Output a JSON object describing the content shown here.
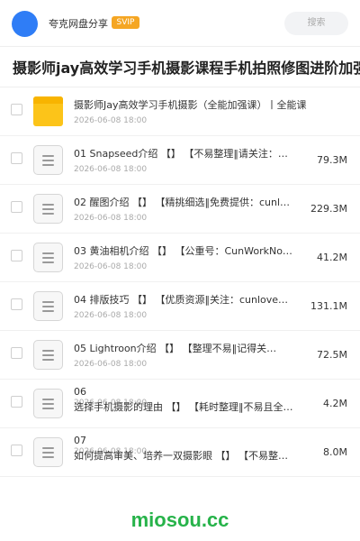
{
  "header": {
    "owner_name": "夸克网盘分享",
    "badge": "SVIP",
    "search_placeholder": "搜索"
  },
  "share_title": "摄影师jay高效学习手机摄影课程手机拍照修图进阶加强版教程",
  "files": [
    {
      "type": "folder",
      "name": "摄影师Jay高效学习手机摄影（全能加强课）丨全能课",
      "date": "2026-06-08 18:00",
      "size": ""
    },
    {
      "type": "file",
      "name": "01 Snapseed介绍 【】 【不易整理‖请关注：…",
      "date": "2026-06-08 18:00",
      "size": "79.3M"
    },
    {
      "type": "file",
      "name": "02 醒图介绍 【】 【精挑细选‖免费提供：cunlo…",
      "date": "2026-06-08 18:00",
      "size": "229.3M"
    },
    {
      "type": "file",
      "name": "03 黄油相机介绍 【】 【公重号：CunWorkNo…",
      "date": "2026-06-08 18:00",
      "size": "41.2M"
    },
    {
      "type": "file",
      "name": "04 排版技巧 【】 【优质资源‖关注：cunlove…",
      "date": "2026-06-08 18:00",
      "size": "131.1M"
    },
    {
      "type": "file",
      "name": "05 Lightroon介绍 【】 【整理不易‖记得关…",
      "date": "2026-06-08 18:00",
      "size": "72.5M"
    },
    {
      "type": "file",
      "name": "06",
      "name2": "选择手机摄影的理由 【】 【耗时整理‖不易且全免…",
      "date": "2026-06-08 18:00",
      "size": "4.2M"
    },
    {
      "type": "file",
      "name": "07",
      "name2": "如何提高审美、培养一双摄影眼 【】 【不易整理‖…",
      "date": "2026-06-08 18:00",
      "size": "8.0M"
    }
  ],
  "watermark": "miosou.cc",
  "colors": {
    "accent": "#2f7df6",
    "svip": "#f5a623",
    "folder": "#fcc419",
    "watermark": "#27b34a"
  }
}
